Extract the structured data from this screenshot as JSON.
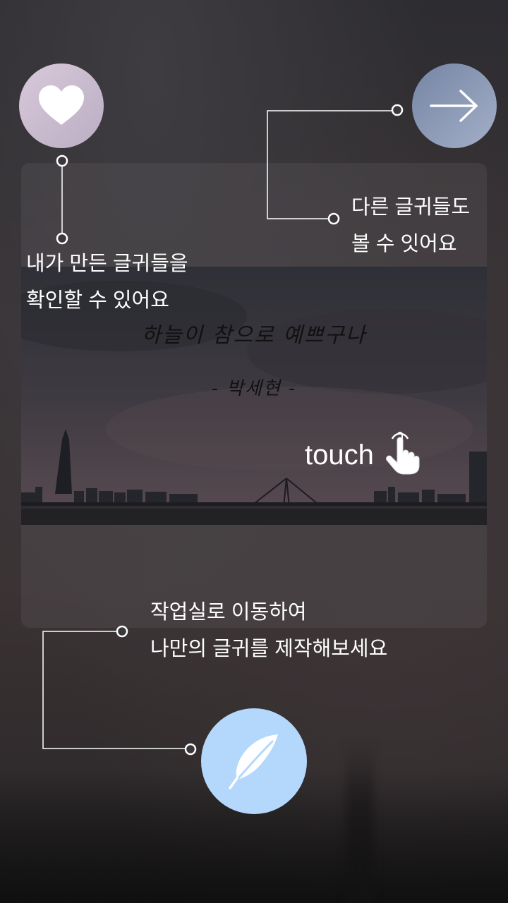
{
  "guide": {
    "heart_callout": {
      "line1": "내가 만든 글귀들을",
      "line2": "확인할 수 있어요"
    },
    "arrow_callout": {
      "line1": "다른 글귀들도",
      "line2": "볼 수 잇어요"
    },
    "pen_callout": {
      "line1": "작업실로 이동하여",
      "line2": "나만의 글귀를 제작해보세요"
    }
  },
  "preview": {
    "quote": "하늘이 참으로 예쁘구나",
    "author": "- 박세현 -",
    "touch_label": "touch"
  },
  "icons": {
    "heart": "heart-icon",
    "arrow": "arrow-right-icon",
    "pen": "feather-pen-icon",
    "hand": "pointing-hand-icon"
  },
  "colors": {
    "heart_button": "#c8bbcc",
    "arrow_button": "#8c99b7",
    "pen_button": "#b4d8fb",
    "guide_lines": "#ffffff"
  }
}
